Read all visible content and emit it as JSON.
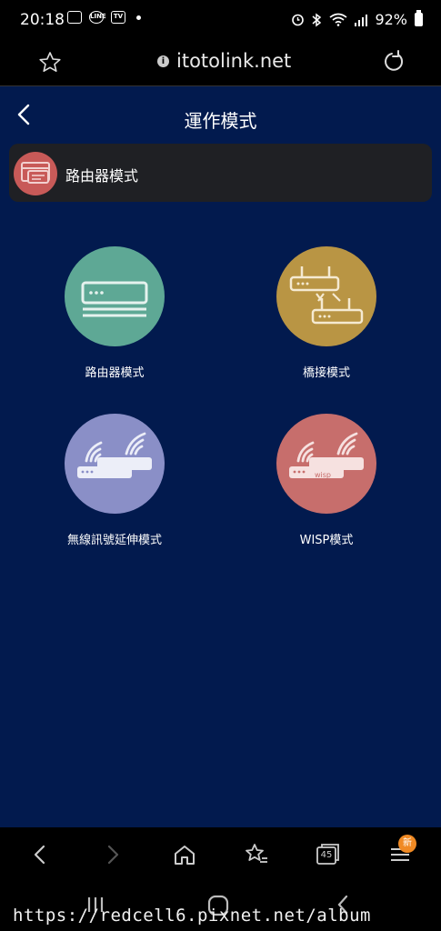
{
  "status": {
    "time": "20:18",
    "left_icons": [
      "image-icon",
      "line-app-icon",
      "tv-app-icon",
      "notification-dot-icon"
    ],
    "right_icons": [
      "alarm-icon",
      "bluetooth-icon",
      "wifi-icon",
      "signal-icon",
      "battery-icon"
    ],
    "battery": "92%"
  },
  "browser": {
    "url": "itotolink.net"
  },
  "page": {
    "title": "運作模式",
    "current_mode": "路由器模式"
  },
  "modes": [
    {
      "label": "路由器模式",
      "color": "#5ea895"
    },
    {
      "label": "橋接模式",
      "color": "#b99544"
    },
    {
      "label": "無線訊號延伸模式",
      "color": "#8a8fc7"
    },
    {
      "label": "WISP模式",
      "color": "#c76e6c",
      "icon_text": "wisp"
    }
  ],
  "bottom_nav": {
    "tabs_count": "45",
    "badge": "新"
  },
  "watermark": "https://redcell6.pixnet.net/album"
}
